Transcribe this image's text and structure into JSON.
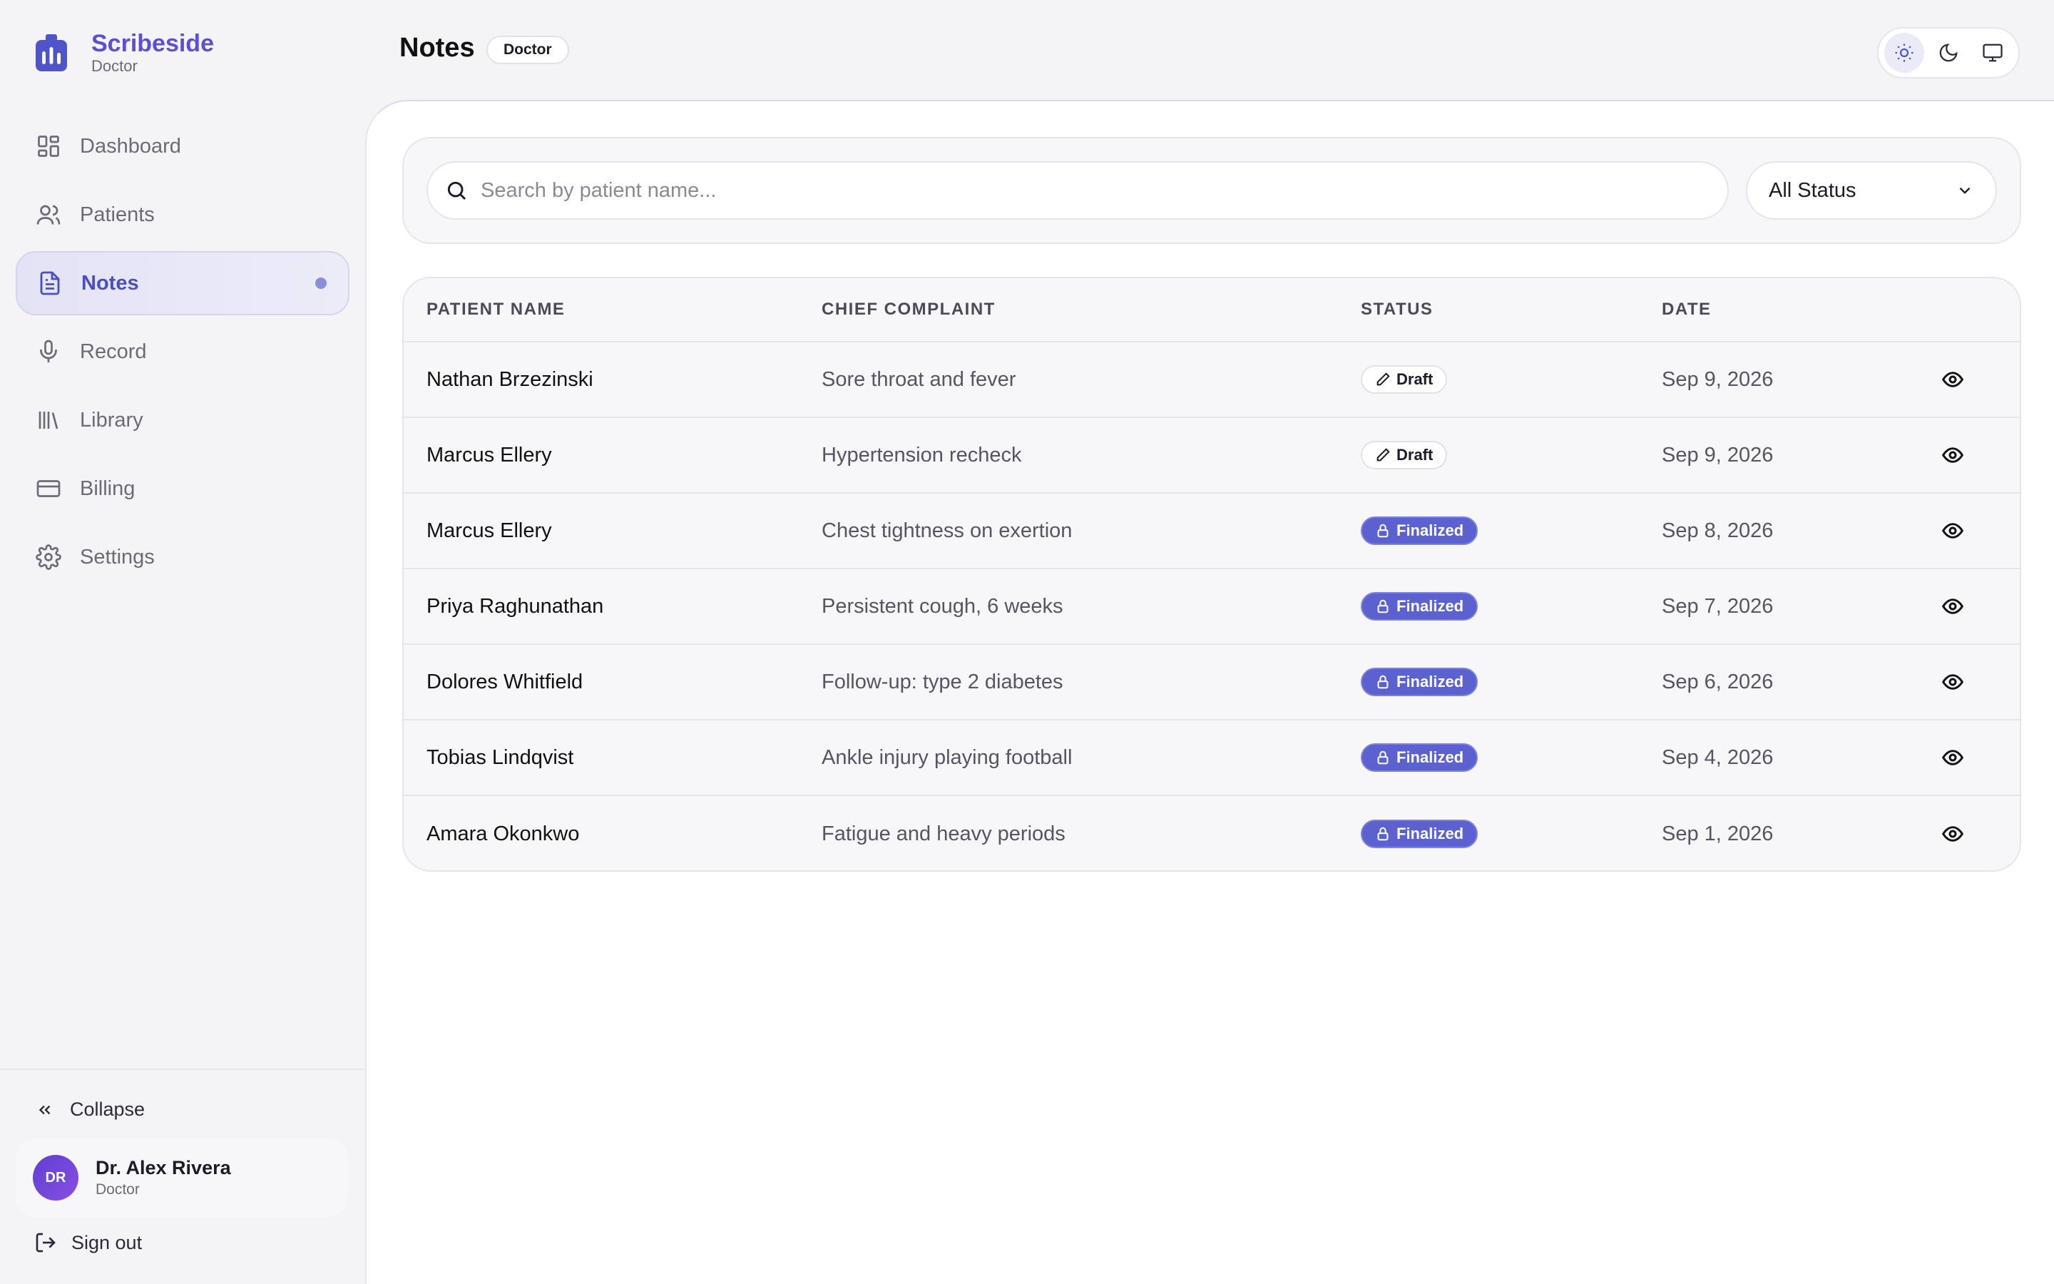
{
  "brand": {
    "name": "Scribeside",
    "role": "Doctor"
  },
  "nav": {
    "items": [
      {
        "label": "Dashboard",
        "icon": "dashboard-icon"
      },
      {
        "label": "Patients",
        "icon": "users-icon"
      },
      {
        "label": "Notes",
        "icon": "file-text-icon",
        "active": true
      },
      {
        "label": "Record",
        "icon": "mic-icon"
      },
      {
        "label": "Library",
        "icon": "library-icon"
      },
      {
        "label": "Billing",
        "icon": "credit-card-icon"
      },
      {
        "label": "Settings",
        "icon": "gear-icon"
      }
    ],
    "collapse_label": "Collapse",
    "signout_label": "Sign out"
  },
  "user": {
    "initials": "DR",
    "name": "Dr. Alex Rivera",
    "role": "Doctor"
  },
  "header": {
    "title": "Notes",
    "role_badge": "Doctor",
    "theme_options": [
      "sun-icon",
      "moon-icon",
      "monitor-icon"
    ],
    "theme_active": "sun-icon"
  },
  "filters": {
    "search_placeholder": "Search by patient name...",
    "search_value": "",
    "status_selected": "All Status"
  },
  "table": {
    "headers": [
      "PATIENT NAME",
      "CHIEF COMPLAINT",
      "STATUS",
      "DATE"
    ],
    "rows": [
      {
        "name": "Nathan Brzezinski",
        "complaint": "Sore throat and fever",
        "status": "Draft",
        "date": "Sep 9, 2026"
      },
      {
        "name": "Marcus Ellery",
        "complaint": "Hypertension recheck",
        "status": "Draft",
        "date": "Sep 9, 2026"
      },
      {
        "name": "Marcus Ellery",
        "complaint": "Chest tightness on exertion",
        "status": "Finalized",
        "date": "Sep 8, 2026"
      },
      {
        "name": "Priya Raghunathan",
        "complaint": "Persistent cough, 6 weeks",
        "status": "Finalized",
        "date": "Sep 7, 2026"
      },
      {
        "name": "Dolores Whitfield",
        "complaint": "Follow-up: type 2 diabetes",
        "status": "Finalized",
        "date": "Sep 6, 2026"
      },
      {
        "name": "Tobias Lindqvist",
        "complaint": "Ankle injury playing football",
        "status": "Finalized",
        "date": "Sep 4, 2026"
      },
      {
        "name": "Amara Okonkwo",
        "complaint": "Fatigue and heavy periods",
        "status": "Finalized",
        "date": "Sep 1, 2026"
      }
    ]
  },
  "colors": {
    "accent": "#5b62cf",
    "brand": "#5b4fd6",
    "background": "#f4f4f7"
  }
}
